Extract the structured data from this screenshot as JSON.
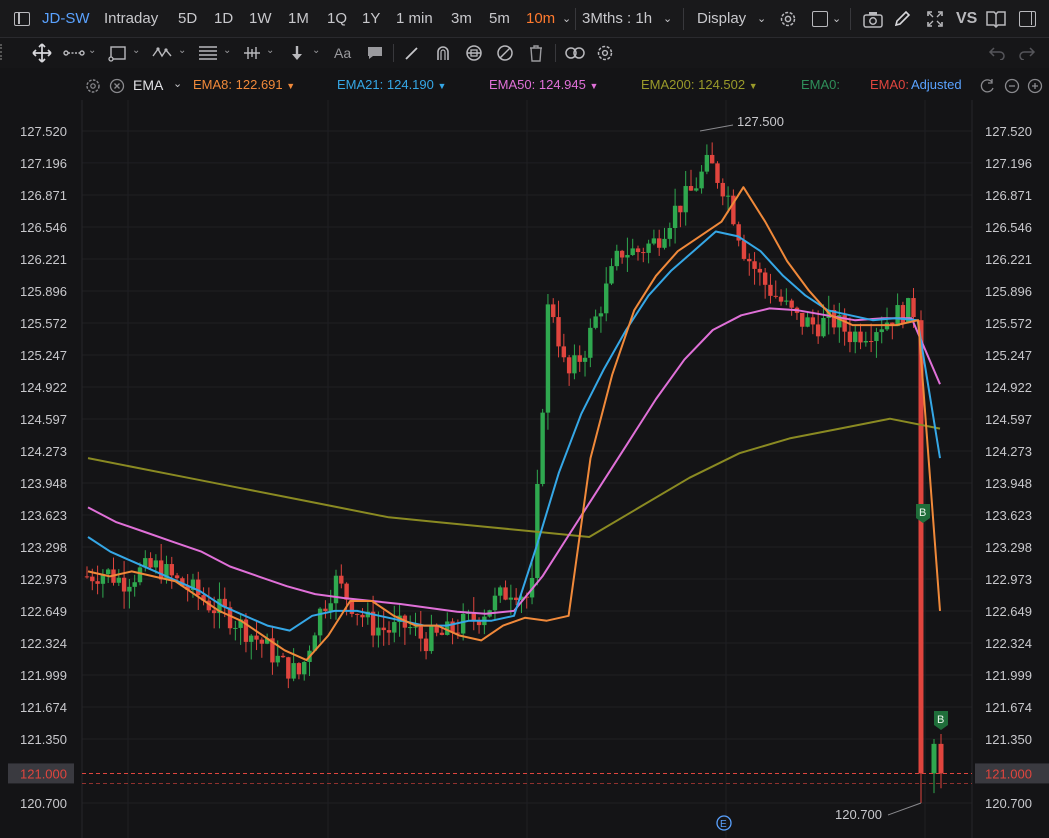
{
  "topbar": {
    "symbol": "JD-SW",
    "timeframes": [
      "Intraday",
      "5D",
      "1D",
      "1W",
      "1M",
      "1Q",
      "1Y",
      "1 min",
      "3m",
      "5m",
      "10m"
    ],
    "active_timeframe": "10m",
    "range_label": "3Mths : 1h",
    "display_label": "Display",
    "vs_label": "VS"
  },
  "toolbar": {
    "text_tool": "Aa"
  },
  "indicator": {
    "name": "EMA",
    "lines": [
      {
        "label": "EMA8:",
        "value": "122.691",
        "color": "#f0893a"
      },
      {
        "label": "EMA21:",
        "value": "124.190",
        "color": "#35a7e6"
      },
      {
        "label": "EMA50:",
        "value": "124.945",
        "color": "#e070d8"
      },
      {
        "label": "EMA200:",
        "value": "124.502",
        "color": "#9a9a2a"
      },
      {
        "label": "EMA0:",
        "value": "",
        "color": "#2f8f5a"
      },
      {
        "label": "EMA0:",
        "value": "",
        "color": "#e0453e"
      }
    ],
    "adjusted_label": "Adjusted"
  },
  "chart_data": {
    "type": "candlestick",
    "y_ticks": [
      "127.520",
      "127.196",
      "126.871",
      "126.546",
      "126.221",
      "125.896",
      "125.572",
      "125.247",
      "124.922",
      "124.597",
      "124.273",
      "123.948",
      "123.623",
      "123.298",
      "122.973",
      "122.649",
      "122.324",
      "121.999",
      "121.674",
      "121.350",
      "120.700"
    ],
    "ylim": [
      120.55,
      127.72
    ],
    "current_price": "121.000",
    "high_label": "127.500",
    "low_label": "120.700",
    "marker_label": "B",
    "event_label": "E",
    "colors": {
      "up": "#2fa84f",
      "down": "#e0453e",
      "grid": "#1f1f23"
    },
    "ema8": [
      123.05,
      123.0,
      123.05,
      123.0,
      122.95,
      122.8,
      122.65,
      122.55,
      122.4,
      122.25,
      122.15,
      122.4,
      122.75,
      122.75,
      122.6,
      122.5,
      122.5,
      122.4,
      122.35,
      122.5,
      122.58,
      122.55,
      122.6,
      124.2,
      125.05,
      125.7,
      126.05,
      126.3,
      126.45,
      126.6,
      126.95,
      126.6,
      126.2,
      125.9,
      125.65,
      125.55,
      125.55,
      125.55,
      125.6,
      122.65
    ],
    "ema21": [
      123.4,
      123.25,
      123.15,
      123.05,
      122.95,
      122.85,
      122.7,
      122.6,
      122.5,
      122.45,
      122.6,
      122.65,
      122.65,
      122.6,
      122.55,
      122.5,
      122.5,
      122.55,
      122.55,
      122.6,
      123.3,
      124.05,
      124.65,
      125.1,
      125.5,
      125.85,
      126.1,
      126.3,
      126.5,
      126.45,
      126.3,
      126.05,
      125.85,
      125.7,
      125.65,
      125.6,
      125.62,
      125.6,
      124.2
    ],
    "ema50": [
      123.7,
      123.55,
      123.45,
      123.35,
      123.25,
      123.1,
      123.0,
      122.9,
      122.82,
      122.78,
      122.75,
      122.72,
      122.68,
      122.64,
      122.62,
      122.65,
      123.0,
      123.45,
      123.9,
      124.35,
      124.8,
      125.2,
      125.5,
      125.65,
      125.72,
      125.7,
      125.65,
      125.6,
      125.62,
      125.62,
      124.95
    ],
    "ema200": [
      124.2,
      124.1,
      124.0,
      123.9,
      123.8,
      123.7,
      123.6,
      123.55,
      123.5,
      123.45,
      123.4,
      123.7,
      124.0,
      124.25,
      124.4,
      124.5,
      124.6,
      124.5
    ]
  }
}
